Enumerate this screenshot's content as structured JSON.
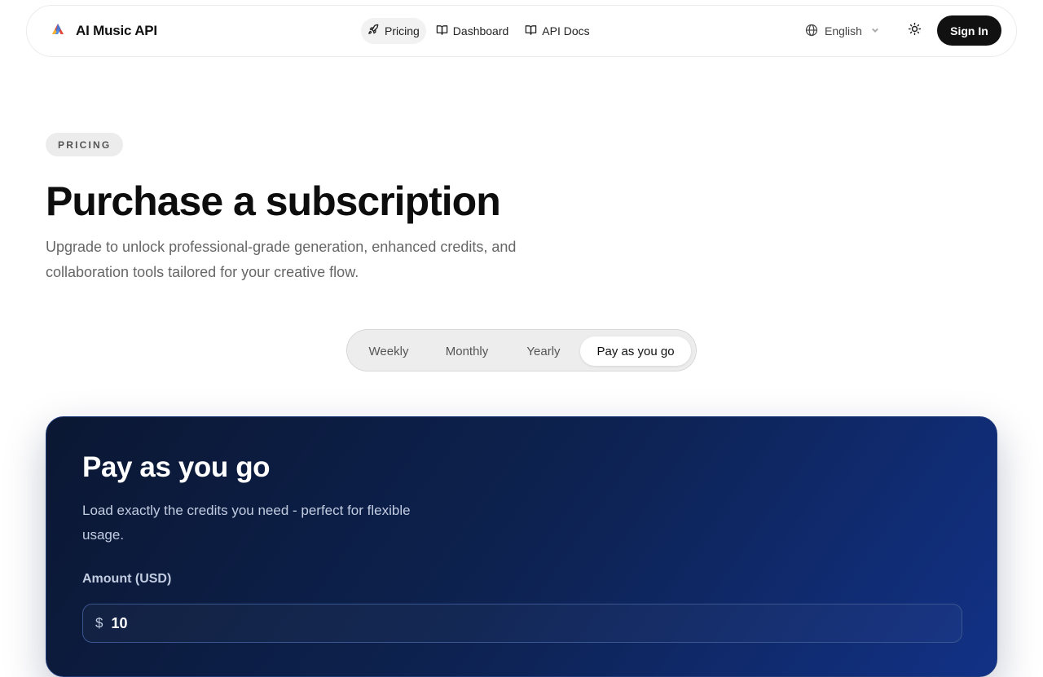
{
  "header": {
    "brand": "AI Music API",
    "nav": [
      {
        "label": "Pricing",
        "icon": "rocket-icon",
        "active": true
      },
      {
        "label": "Dashboard",
        "icon": "book-icon"
      },
      {
        "label": "API Docs",
        "icon": "book-icon"
      }
    ],
    "language": "English",
    "signin": "Sign In"
  },
  "hero": {
    "pill": "PRICING",
    "title": "Purchase a subscription",
    "subtitle": "Upgrade to unlock professional‑grade generation, enhanced credits, and collaboration tools tailored for your creative flow."
  },
  "billing_toggle": {
    "options": [
      "Weekly",
      "Monthly",
      "Yearly",
      "Pay as you go"
    ],
    "selected": "Pay as you go"
  },
  "plan": {
    "title": "Pay as you go",
    "description": "Load exactly the credits you need - perfect for flexible usage.",
    "amount_label": "Amount (USD)",
    "currency_symbol": "$",
    "amount_value": "10"
  },
  "colors": {
    "card_gradient_start": "#0b1733",
    "card_gradient_end": "#123186",
    "signin_bg": "#111111"
  }
}
